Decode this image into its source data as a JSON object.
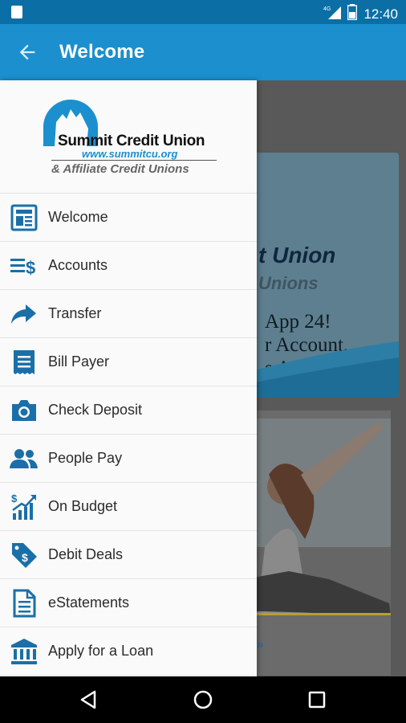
{
  "status_bar": {
    "time": "12:40",
    "network": "4G"
  },
  "app_bar": {
    "title": "Welcome",
    "back_icon": "arrow-left-icon"
  },
  "logo": {
    "name": "Summit Credit Union",
    "url": "www.summitcu.org",
    "tagline": "& Affiliate Credit Unions"
  },
  "menu": {
    "items": [
      {
        "label": "Welcome",
        "icon": "newspaper-icon"
      },
      {
        "label": "Accounts",
        "icon": "accounts-list-icon"
      },
      {
        "label": "Transfer",
        "icon": "share-arrow-icon"
      },
      {
        "label": "Bill Payer",
        "icon": "receipt-icon"
      },
      {
        "label": "Check Deposit",
        "icon": "camera-icon"
      },
      {
        "label": "People Pay",
        "icon": "people-icon"
      },
      {
        "label": "On Budget",
        "icon": "growth-chart-icon"
      },
      {
        "label": "Debit Deals",
        "icon": "price-tag-icon"
      },
      {
        "label": "eStatements",
        "icon": "document-icon"
      },
      {
        "label": "Apply for a Loan",
        "icon": "bank-icon"
      }
    ]
  },
  "background": {
    "banner_name": "t Union",
    "banner_sub": "Unions",
    "lines": [
      "App 24!",
      "r Account,",
      "s And More."
    ],
    "more_link": "»"
  },
  "colors": {
    "primary": "#1c8fce",
    "status": "#0b6fa6",
    "icon": "#1a6fa8"
  }
}
